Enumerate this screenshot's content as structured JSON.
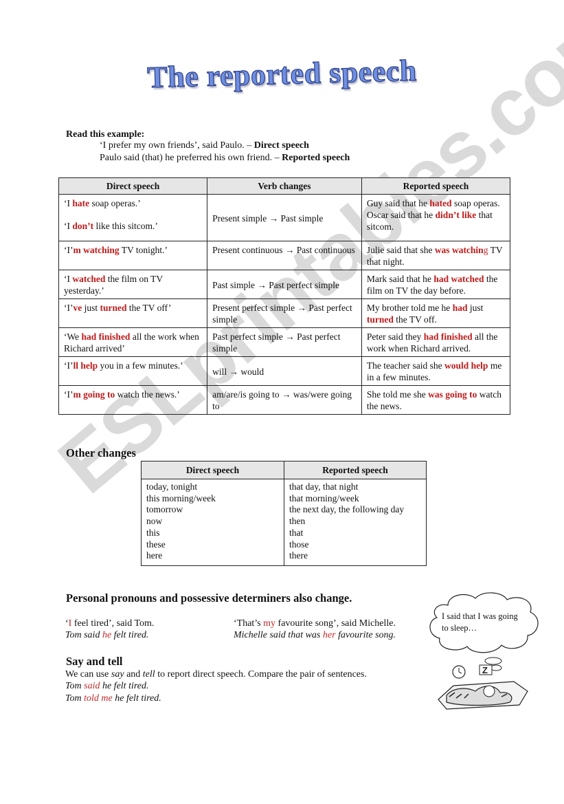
{
  "title": "The reported speech",
  "intro": {
    "heading": "Read this example:",
    "line1_text": "‘I prefer my own friends’, said Paulo. – ",
    "line1_label": "Direct speech",
    "line2_text": "Paulo said (that) he preferred his own friend. – ",
    "line2_label": "Reported speech"
  },
  "verb_table": {
    "headers": [
      "Direct speech",
      "Verb changes",
      "Reported speech"
    ],
    "rows": [
      {
        "direct": [
          [
            "‘I ",
            ""
          ],
          [
            "hate",
            "red"
          ],
          [
            " soap operas.’",
            ""
          ]
        ],
        "direct2": [
          [
            "‘I ",
            ""
          ],
          [
            "don’t",
            "red"
          ],
          [
            " ",
            ""
          ],
          [
            "like",
            "bold"
          ],
          [
            " this sitcom.’",
            ""
          ]
        ],
        "change": "Present simple → Past simple",
        "reported": [
          [
            "Guy said that he ",
            ""
          ],
          [
            "hated",
            "red"
          ],
          [
            " soap operas.",
            ""
          ]
        ],
        "reported2": [
          [
            "Oscar said that he ",
            ""
          ],
          [
            "didn’t like",
            "red"
          ],
          [
            " that sitcom.",
            ""
          ]
        ]
      },
      {
        "direct": [
          [
            "‘I’",
            ""
          ],
          [
            "m watching",
            "red"
          ],
          [
            " TV tonight.’",
            ""
          ]
        ],
        "change": "Present continuous → Past continuous",
        "reported": [
          [
            "Julie said that she ",
            ""
          ],
          [
            "was watchin",
            "red"
          ],
          [
            "g",
            "redi"
          ],
          [
            " TV that night.",
            ""
          ]
        ]
      },
      {
        "direct": [
          [
            "‘I ",
            ""
          ],
          [
            "watched",
            "red"
          ],
          [
            " the film on TV yesterday.’",
            ""
          ]
        ],
        "change": "Past simple → Past perfect simple",
        "reported": [
          [
            "Mark said that he ",
            ""
          ],
          [
            "had watched",
            "red"
          ],
          [
            " the film on TV the day before.",
            ""
          ]
        ]
      },
      {
        "direct": [
          [
            "‘I’",
            ""
          ],
          [
            "ve",
            "red"
          ],
          [
            " just ",
            ""
          ],
          [
            "turned",
            "red"
          ],
          [
            " the TV off’",
            ""
          ]
        ],
        "change": "Present perfect simple → Past perfect simple",
        "reported": [
          [
            "My brother told me he ",
            ""
          ],
          [
            "had",
            "red"
          ],
          [
            " just ",
            ""
          ],
          [
            "turned",
            "red"
          ],
          [
            " the TV off.",
            ""
          ]
        ]
      },
      {
        "direct": [
          [
            "‘We ",
            ""
          ],
          [
            "had finished",
            "red"
          ],
          [
            " all the work when Richard arrived’",
            ""
          ]
        ],
        "change": "Past perfect simple → Past perfect simple",
        "reported": [
          [
            "Peter said they ",
            ""
          ],
          [
            "had finished",
            "red"
          ],
          [
            " all the work when Richard arrived.",
            ""
          ]
        ]
      },
      {
        "direct": [
          [
            "‘I’",
            ""
          ],
          [
            "ll help",
            "red"
          ],
          [
            " you in a few minutes.’",
            ""
          ]
        ],
        "change": "will → would",
        "reported": [
          [
            "The teacher said she ",
            ""
          ],
          [
            "would help",
            "red"
          ],
          [
            " me in a few minutes.",
            ""
          ]
        ]
      },
      {
        "direct": [
          [
            "‘I’",
            ""
          ],
          [
            "m going to",
            "red"
          ],
          [
            " watch the news.’",
            ""
          ]
        ],
        "change": "am/are/is going to → was/were going to",
        "reported": [
          [
            "She told me she ",
            ""
          ],
          [
            "was going to",
            "red"
          ],
          [
            " watch the news.",
            ""
          ]
        ]
      }
    ]
  },
  "other_changes": {
    "heading": "Other changes",
    "headers": [
      "Direct speech",
      "Reported speech"
    ],
    "direct": [
      "today, tonight",
      "this morning/week",
      "tomorrow",
      "now",
      "this",
      "these",
      "here"
    ],
    "reported": [
      "that day, that night",
      "that morning/week",
      "the next day, the following day",
      "then",
      "that",
      "those",
      "there"
    ]
  },
  "pronouns": {
    "heading": "Personal pronouns and possessive determiners also change.",
    "ex1_direct": [
      [
        "‘",
        ""
      ],
      [
        "I",
        "redi"
      ],
      [
        " feel tired’, said Tom.",
        ""
      ]
    ],
    "ex1_reported": [
      [
        "Tom said ",
        ""
      ],
      [
        "he",
        "redi"
      ],
      [
        " felt tired.",
        ""
      ]
    ],
    "ex2_direct": [
      [
        "‘That’s ",
        ""
      ],
      [
        "my",
        "redi"
      ],
      [
        " favourite song’, said Michelle.",
        ""
      ]
    ],
    "ex2_reported": [
      [
        "Michelle said that was ",
        ""
      ],
      [
        "her",
        "redi"
      ],
      [
        " favourite song.",
        ""
      ]
    ]
  },
  "say_tell": {
    "heading": "Say and tell",
    "intro": [
      [
        "We can use ",
        ""
      ],
      [
        "say",
        "it"
      ],
      [
        " and ",
        ""
      ],
      [
        "tell",
        "it"
      ],
      [
        " to report direct speech. Compare the pair of sentences.",
        ""
      ]
    ],
    "ex1": [
      [
        "Tom ",
        ""
      ],
      [
        "said",
        "redi"
      ],
      [
        " he felt tired.",
        ""
      ]
    ],
    "ex2": [
      [
        "Tom ",
        ""
      ],
      [
        "told me",
        "redi"
      ],
      [
        " he felt tired.",
        ""
      ]
    ]
  },
  "cartoon": {
    "bubble_text": "I said that I was going to sleep…",
    "icon": "sleeping-cat-illustration"
  },
  "watermark": "ESLprintables.com",
  "colors": {
    "highlight": "#c01a1a",
    "header_bg": "#e6e6e6",
    "title": "#6f8fe0"
  }
}
